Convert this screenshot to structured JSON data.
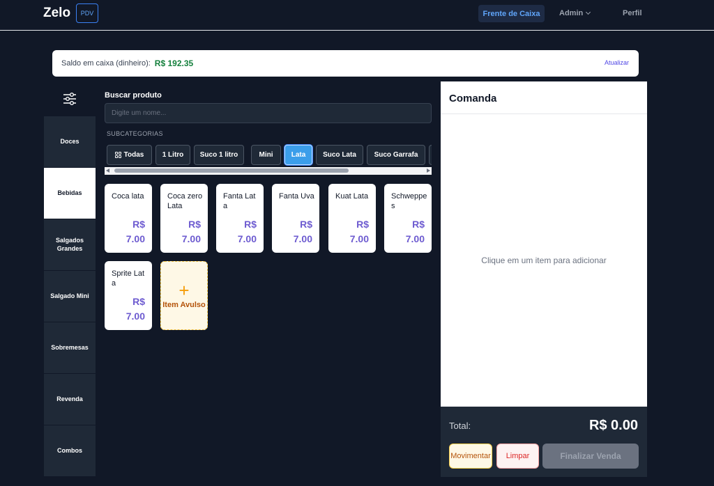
{
  "header": {
    "brand": "Zelo",
    "badge": "PDV",
    "nav_active": "Frente de Caixa",
    "nav_admin": "Admin",
    "nav_perfil": "Perfil"
  },
  "saldo": {
    "label": "Saldo em caixa (dinheiro):",
    "value": "R$ 192.35",
    "refresh": "Atualizar"
  },
  "sidebar": {
    "items": [
      {
        "label": "Doces",
        "active": false
      },
      {
        "label": "Bebidas",
        "active": true
      },
      {
        "label": "Salgados Grandes",
        "active": false
      },
      {
        "label": "Salgado Mini",
        "active": false
      },
      {
        "label": "Sobremesas",
        "active": false
      },
      {
        "label": "Revenda",
        "active": false
      },
      {
        "label": "Combos",
        "active": false
      }
    ]
  },
  "search": {
    "label": "Buscar produto",
    "placeholder": "Digite um nome..."
  },
  "subcategories": {
    "label": "SUBCATEGORIAS",
    "chips": [
      {
        "label": "Todas",
        "active": false
      },
      {
        "label": "1 Litro",
        "active": false
      },
      {
        "label": "Suco 1 litro",
        "active": false
      },
      {
        "label": "Mini",
        "active": false
      },
      {
        "label": "Lata",
        "active": true
      },
      {
        "label": "Suco Lata",
        "active": false
      },
      {
        "label": "Suco Garrafa",
        "active": false
      }
    ]
  },
  "products": [
    {
      "name": "Coca lata",
      "currency": "R$",
      "price": "7.00"
    },
    {
      "name": "Coca zero Lata",
      "currency": "R$",
      "price": "7.00"
    },
    {
      "name": "Fanta Lata",
      "currency": "R$",
      "price": "7.00"
    },
    {
      "name": "Fanta Uva",
      "currency": "R$",
      "price": "7.00"
    },
    {
      "name": "Kuat Lata",
      "currency": "R$",
      "price": "7.00"
    },
    {
      "name": "Schweppes",
      "currency": "R$",
      "price": "7.00"
    },
    {
      "name": "Sprite Lata",
      "currency": "R$",
      "price": "7.00"
    }
  ],
  "avulso": {
    "plus": "+",
    "label": "Item Avulso"
  },
  "comanda": {
    "title": "Comanda",
    "empty": "Clique em um item para adicionar",
    "total_label": "Total:",
    "total_value": "R$ 0.00",
    "btn_movimentar": "Movimentar",
    "btn_limpar": "Limpar",
    "btn_finalizar": "Finalizar Venda"
  }
}
